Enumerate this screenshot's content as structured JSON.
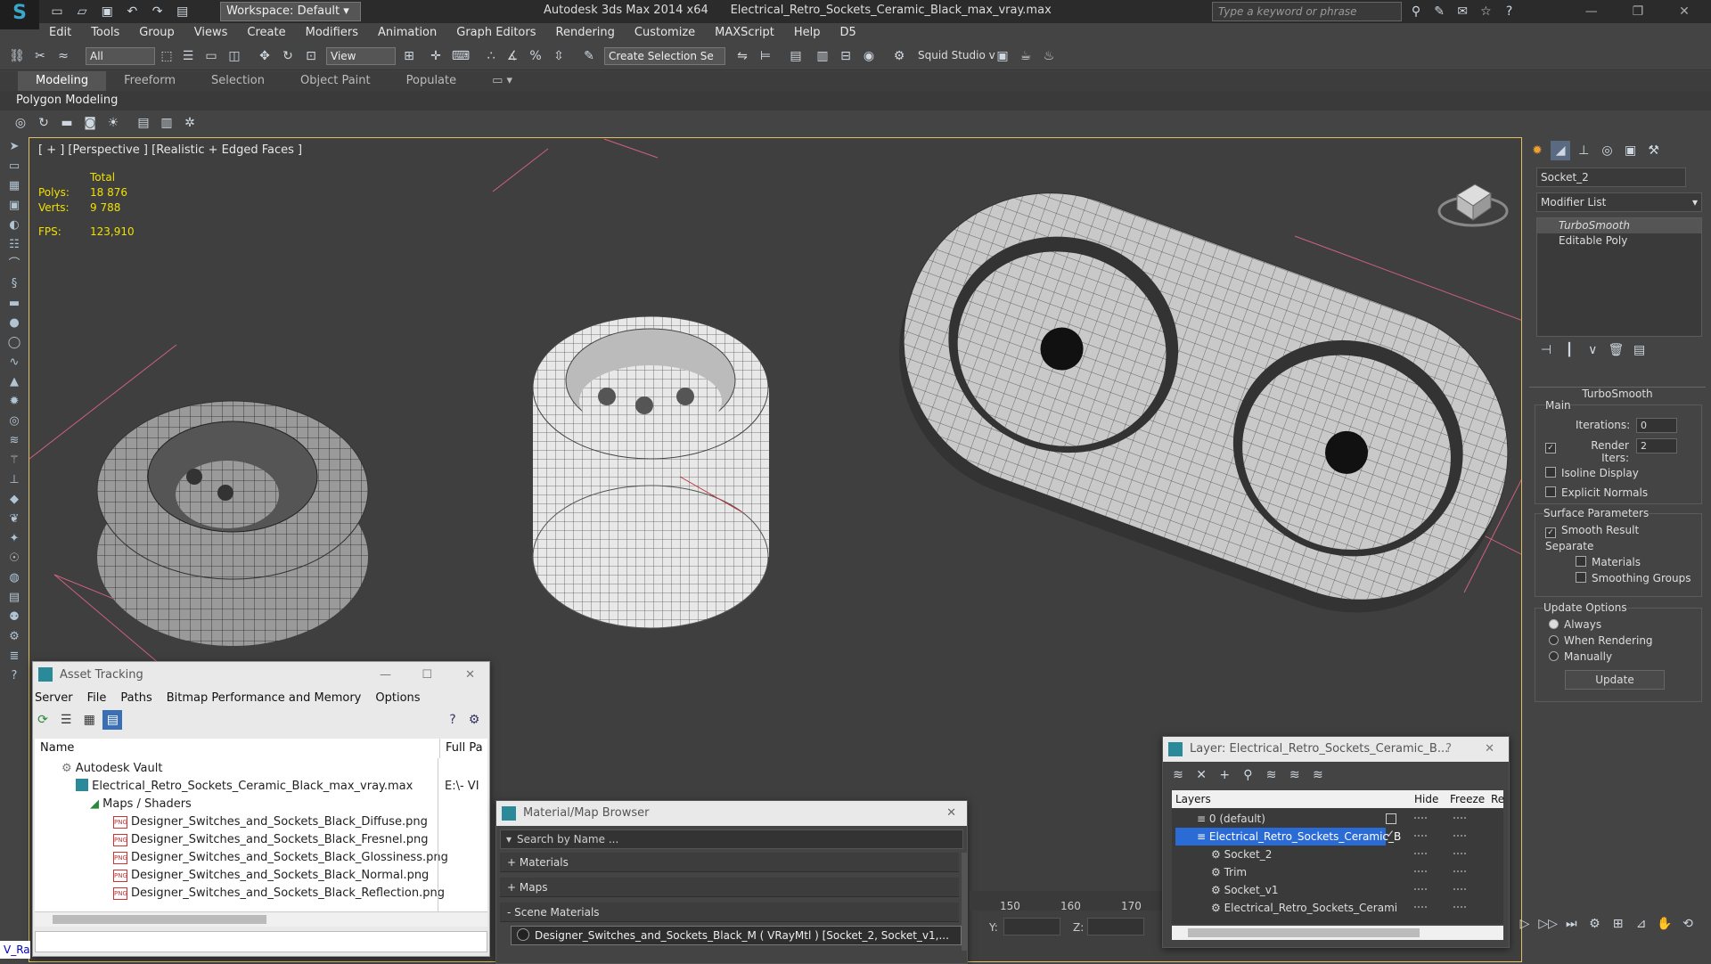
{
  "app": {
    "workspace": "Workspace: Default",
    "title_app": "Autodesk 3ds Max  2014 x64",
    "title_file": "Electrical_Retro_Sockets_Ceramic_Black_max_vray.max",
    "search_placeholder": "Type a keyword or phrase"
  },
  "menu": [
    "Edit",
    "Tools",
    "Group",
    "Views",
    "Create",
    "Modifiers",
    "Animation",
    "Graph Editors",
    "Rendering",
    "Customize",
    "MAXScript",
    "Help",
    "D5"
  ],
  "toolbar": {
    "filter": "All",
    "ref_coord": "View",
    "selection_set": "Create Selection Se",
    "squid": "Squid Studio v"
  },
  "ribbon": {
    "tabs": [
      "Modeling",
      "Freeform",
      "Selection",
      "Object Paint",
      "Populate"
    ],
    "panel": "Polygon Modeling"
  },
  "viewport": {
    "label": "[ + ] [Perspective ] [Realistic + Edged Faces ]",
    "total_label": "Total",
    "polys_label": "Polys:",
    "polys": "18 876",
    "verts_label": "Verts:",
    "verts": "9 788",
    "fps_label": "FPS:",
    "fps": "123,910"
  },
  "command_panel": {
    "object_name": "Socket_2",
    "modifier_list": "Modifier List",
    "stack": [
      "TurboSmooth",
      "Editable Poly"
    ],
    "rollout": "TurboSmooth",
    "main": "Main",
    "iterations_label": "Iterations:",
    "iterations": "0",
    "render_iters_label": "Render Iters:",
    "render_iters": "2",
    "isoline": "Isoline Display",
    "explicit_normals": "Explicit Normals",
    "surface_params": "Surface Parameters",
    "smooth_result": "Smooth Result",
    "separate": "Separate",
    "materials": "Materials",
    "smoothing_groups": "Smoothing Groups",
    "update_options": "Update Options",
    "always": "Always",
    "when_rendering": "When Rendering",
    "manually": "Manually",
    "update": "Update"
  },
  "asset_tracking": {
    "title": "Asset Tracking",
    "menu": [
      "Server",
      "File",
      "Paths",
      "Bitmap Performance and Memory",
      "Options"
    ],
    "col_name": "Name",
    "col_path": "Full Pa",
    "rows": [
      {
        "name": "Autodesk Vault",
        "path": ""
      },
      {
        "name": "Electrical_Retro_Sockets_Ceramic_Black_max_vray.max",
        "path": "E:\\- VI"
      },
      {
        "name": "Maps / Shaders",
        "path": ""
      },
      {
        "name": "Designer_Switches_and_Sockets_Black_Diffuse.png",
        "path": ""
      },
      {
        "name": "Designer_Switches_and_Sockets_Black_Fresnel.png",
        "path": ""
      },
      {
        "name": "Designer_Switches_and_Sockets_Black_Glossiness.png",
        "path": ""
      },
      {
        "name": "Designer_Switches_and_Sockets_Black_Normal.png",
        "path": ""
      },
      {
        "name": "Designer_Switches_and_Sockets_Black_Reflection.png",
        "path": ""
      }
    ]
  },
  "material_browser": {
    "title": "Material/Map Browser",
    "search": "Search by Name ...",
    "sections": [
      "+ Materials",
      "+ Maps",
      "- Scene Materials"
    ],
    "scene_material": "Designer_Switches_and_Sockets_Black_M  ( VRayMtl ) [Socket_2, Socket_v1,..."
  },
  "layer_window": {
    "title": "Layer: Electrical_Retro_Sockets_Ceramic_B...",
    "col_layers": "Layers",
    "col_hide": "Hide",
    "col_freeze": "Freeze",
    "col_re": "Re",
    "rows": [
      "0 (default)",
      "Electrical_Retro_Sockets_Ceramic_B",
      "Socket_2",
      "Trim",
      "Socket_v1",
      "Electrical_Retro_Sockets_Cerami"
    ]
  },
  "timeline": {
    "ticks": [
      "150",
      "160",
      "170"
    ],
    "y_label": "Y:",
    "z_label": "Z:"
  },
  "status": {
    "left_label": "V_Ra"
  }
}
